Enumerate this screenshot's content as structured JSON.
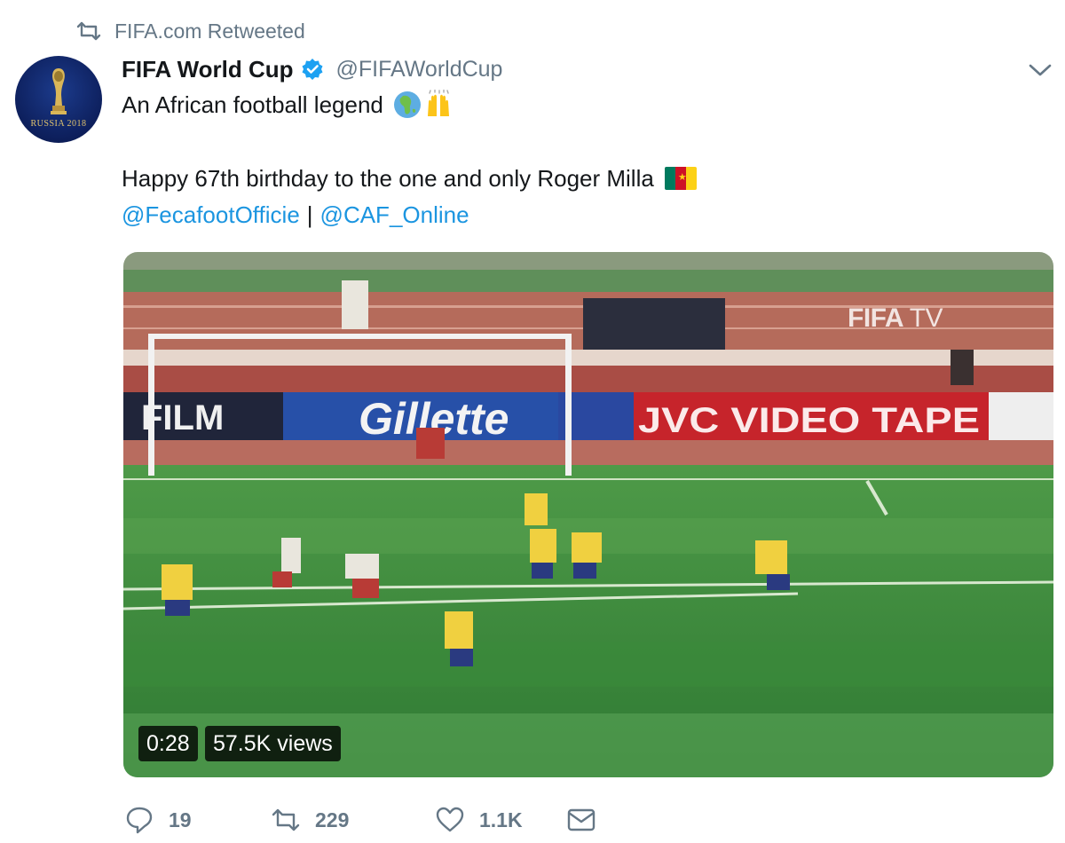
{
  "retweet_context": {
    "icon": "retweet-icon",
    "text": "FIFA.com Retweeted"
  },
  "author": {
    "avatar_text": "RUSSIA 2018",
    "display_name": "FIFA World Cup",
    "verified": true,
    "handle": "@FIFAWorldCup"
  },
  "tweet": {
    "line1": "An African football legend",
    "line1_emojis": [
      "globe-africa-emoji",
      "raised-hands-emoji"
    ],
    "line2": "Happy 67th birthday to the one and only Roger Milla",
    "line2_flag": {
      "name": "cameroon-flag",
      "colors": [
        "#007a5e",
        "#ce1126",
        "#fcd116"
      ]
    },
    "mention1": "@FecafootOfficie",
    "separator": "|",
    "mention2": "@CAF_Online"
  },
  "video": {
    "watermark_brand": "FIFA",
    "watermark_suffix": "TV",
    "ad_board_film": "FILM",
    "ad_board_gillette": "Gillette",
    "ad_board_jvc": "JVC VIDEO TAPE",
    "duration": "0:28",
    "views": "57.5K views"
  },
  "actions": {
    "reply_count": "19",
    "retweet_count": "229",
    "like_count": "1.1K"
  },
  "colors": {
    "link": "#1b95e0",
    "muted": "#657786",
    "verified": "#1da1f2",
    "pitch": "#3e8a3a"
  }
}
